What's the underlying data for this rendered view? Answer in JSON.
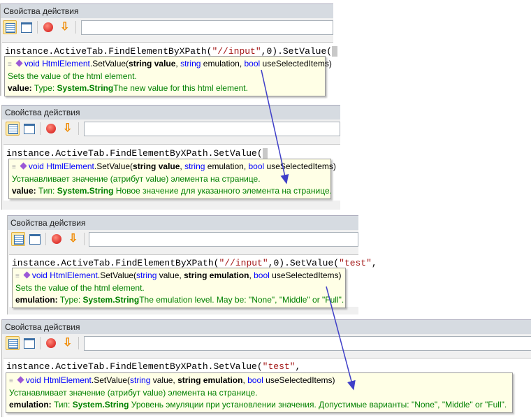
{
  "panel_title": "Свойства действия",
  "arrow_color": "#3f3fc8",
  "panels": [
    {
      "code": {
        "a": "instance.ActiveTab.FindElementByXPath(",
        "s": "\"//input\"",
        "b": ",0).SetValue("
      },
      "sig": {
        "ret": "void",
        "cls": "HtmlElement",
        "method": ".SetValue(",
        "p1t": "string",
        "p1n": "value",
        "p2t": "string",
        "p2n": "emulation",
        "p3t": "bool",
        "p3n": "useSelectedItems)",
        "c1": ", ",
        "c2": ", "
      },
      "summary": "Sets the value of the html element.",
      "param": {
        "name": "value:",
        "type_label": "Type:",
        "type": "System.String",
        "desc": "The new value for this html element."
      }
    },
    {
      "code": {
        "a": "instance.ActiveTab.FindElementByXPath.SetValue("
      },
      "sig": {
        "ret": "void",
        "cls": "HtmlElement",
        "method": ".SetValue(",
        "p1t": "string",
        "p1n": "value",
        "p2t": "string",
        "p2n": "emulation",
        "p3t": "bool",
        "p3n": "useSelectedItems)",
        "c1": ", ",
        "c2": ", "
      },
      "summary": "Устанавливает значение (атрибут value) элемента на странице.",
      "param": {
        "name": "value:",
        "type_label": "Тип:",
        "type": "System.String",
        "desc": "Новое значение для указанного элемента на странице."
      }
    },
    {
      "code": {
        "a": "instance.ActiveTab.FindElementByXPath(",
        "s": "\"//input\"",
        "b": ",0).SetValue(",
        "s2": "\"test\"",
        "c": ","
      },
      "sig": {
        "ret": "void",
        "cls": "HtmlElement",
        "method": ".SetValue(",
        "p1t": "string",
        "p1n": "value",
        "p2t": "string",
        "p2n": "emulation",
        "p3t": "bool",
        "p3n": "useSelectedItems)",
        "c1": ", ",
        "c2": ", "
      },
      "summary": "Sets the value of the html element.",
      "param": {
        "name": "emulation:",
        "type_label": "Type:",
        "type": "System.String",
        "desc": "The emulation level. May be: \"None\", \"Middle\" or \"Full\"."
      }
    },
    {
      "code": {
        "a": "instance.ActiveTab.FindElementByXPath.SetValue(",
        "s2": "\"test\"",
        "c": ","
      },
      "sig": {
        "ret": "void",
        "cls": "HtmlElement",
        "method": ".SetValue(",
        "p1t": "string",
        "p1n": "value",
        "p2t": "string",
        "p2n": "emulation",
        "p3t": "bool",
        "p3n": "useSelectedItems)",
        "c1": ", ",
        "c2": ", "
      },
      "summary": "Устанавливает значение (атрибут value) элемента на странице.",
      "param": {
        "name": "emulation:",
        "type_label": "Тип:",
        "type": "System.String",
        "desc": "Уровень эмуляции при установлении значения. Допустимые варианты: \"None\", \"Middle\" or \"Full\"."
      }
    }
  ]
}
